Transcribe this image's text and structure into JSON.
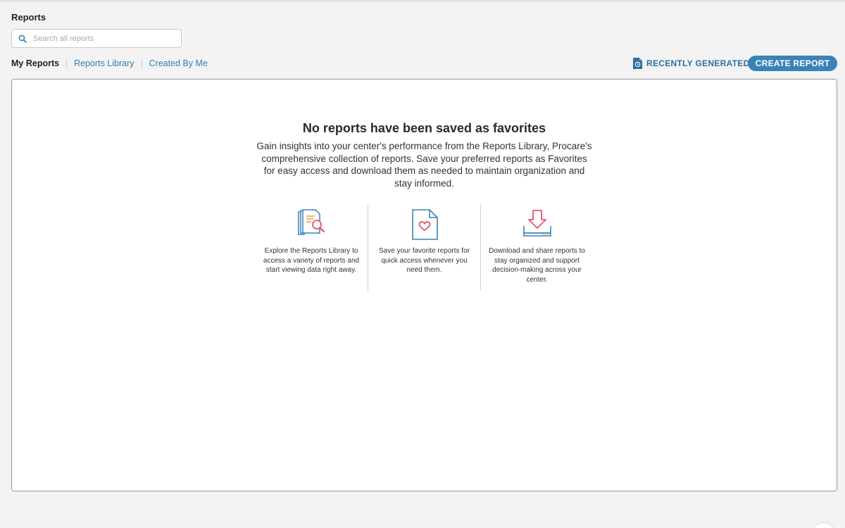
{
  "page": {
    "title": "Reports"
  },
  "search": {
    "placeholder": "Search all reports",
    "value": ""
  },
  "tabs": [
    {
      "label": "My Reports",
      "active": true
    },
    {
      "label": "Reports Library",
      "active": false
    },
    {
      "label": "Created By Me",
      "active": false
    }
  ],
  "actions": {
    "recently_generated": "RECENTLY GENERATED",
    "create_report": "CREATE REPORT"
  },
  "empty_state": {
    "title": "No reports have been saved as favorites",
    "description": "Gain insights into your center's performance from the Reports Library, Procare's comprehensive collection of reports. Save your preferred reports as Favorites for easy access and download them as needed to maintain organization and stay informed.",
    "features": [
      {
        "icon": "reports-library-icon",
        "text": "Explore the Reports Library to access a variety of reports and start viewing data right away."
      },
      {
        "icon": "favorite-document-icon",
        "text": "Save your favorite reports for quick access whenever you need them."
      },
      {
        "icon": "download-tray-icon",
        "text": "Download and share reports to stay organized and support decision-making across your center."
      }
    ]
  },
  "colors": {
    "accent": "#3a83b8",
    "link": "#2f7fb3",
    "icon_secondary": "#f0a44b",
    "icon_heart": "#e8546a"
  }
}
